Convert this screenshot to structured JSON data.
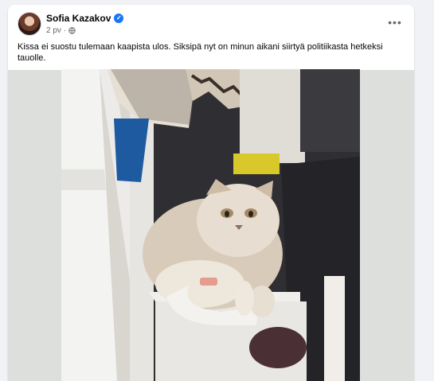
{
  "post": {
    "author": "Sofia Kazakov",
    "time": "2 pv",
    "separator": "·",
    "more_label": "•••",
    "verified_label": "✓",
    "text": "Kissa ei suostu tulemaan kaapista ulos. Siksipä nyt on minun aikani siirtyä politiikasta hetkeksi tauolle."
  },
  "icons": {
    "verified": "verified-badge-icon",
    "audience": "globe-icon",
    "more": "more-options-icon"
  },
  "colors": {
    "background": "#f0f2f5",
    "card": "#ffffff",
    "text": "#050505",
    "secondary_text": "#65676b",
    "verified_blue": "#1877f2"
  }
}
